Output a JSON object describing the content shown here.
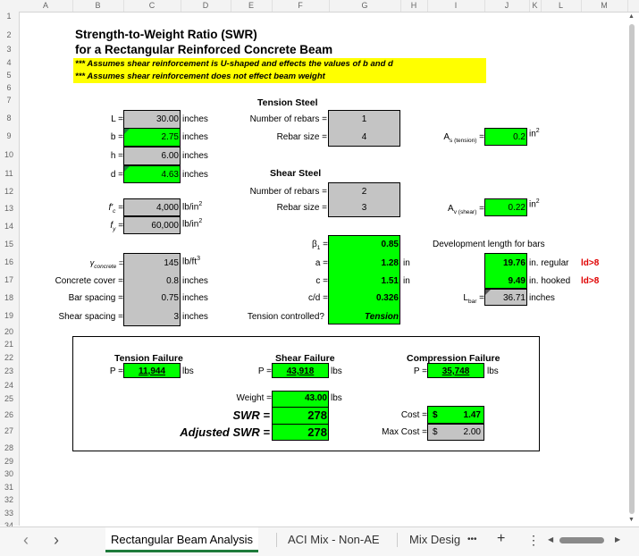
{
  "columns": [
    "A",
    "B",
    "C",
    "D",
    "E",
    "F",
    "G",
    "H",
    "I",
    "J",
    "K",
    "L",
    "M"
  ],
  "rows": [
    "1",
    "2",
    "3",
    "4",
    "5",
    "6",
    "7",
    "8",
    "9",
    "10",
    "11",
    "12",
    "13",
    "14",
    "15",
    "16",
    "17",
    "18",
    "19",
    "20",
    "21",
    "22",
    "23",
    "24",
    "25",
    "26",
    "27",
    "28",
    "29",
    "30",
    "31",
    "32",
    "33",
    "34"
  ],
  "title1": "Strength-to-Weight Ratio (SWR)",
  "title2": "for a Rectangular Reinforced Concrete Beam",
  "note1": "*** Assumes shear reinforcement is U-shaped and effects the values of b and d",
  "note2": "*** Assumes shear reinforcement does not effect beam weight",
  "dims": {
    "L_label": "L =",
    "L_val": "30.00",
    "L_unit": "inches",
    "b_label": "b =",
    "b_val": "2.75",
    "b_unit": "inches",
    "h_label": "h =",
    "h_val": "6.00",
    "h_unit": "inches",
    "d_label": "d =",
    "d_val": "4.63",
    "d_unit": "inches"
  },
  "materials": {
    "fc_label": "f'",
    "fc_sub": "c",
    "fc_eq": " =",
    "fc_val": "4,000",
    "fc_unit": "lb/in",
    "fc_sup": "2",
    "fy_label": "f",
    "fy_sub": "y",
    "fy_eq": " =",
    "fy_val": "60,000",
    "fy_unit": "lb/in",
    "fy_sup": "2"
  },
  "props": {
    "gamma_label": "γ",
    "gamma_sub": "concrete",
    "gamma_eq": " =",
    "gamma_val": "145",
    "gamma_unit": "lb/ft",
    "gamma_sup": "3",
    "cover_label": "Concrete cover =",
    "cover_val": "0.8",
    "cover_unit": "inches",
    "barsp_label": "Bar spacing =",
    "barsp_val": "0.75",
    "barsp_unit": "inches",
    "shearsp_label": "Shear spacing =",
    "shearsp_val": "3",
    "shearsp_unit": "inches"
  },
  "tension_steel": {
    "header": "Tension Steel",
    "num_label": "Number of rebars =",
    "num_val": "1",
    "size_label": "Rebar size =",
    "size_val": "4",
    "as_label": "A",
    "as_sub": "s (tension)",
    "as_eq": " =",
    "as_val": "0.2",
    "as_unit": "in",
    "as_sup": "2"
  },
  "shear_steel": {
    "header": "Shear Steel",
    "num_label": "Number of rebars =",
    "num_val": "2",
    "size_label": "Rebar size =",
    "size_val": "3",
    "av_label": "A",
    "av_sub": "v (shear)",
    "av_eq": " =",
    "av_val": "0.22",
    "av_unit": "in",
    "av_sup": "2"
  },
  "calc": {
    "beta_label": "β",
    "beta_sub": "1",
    "beta_eq": " =",
    "beta_val": "0.85",
    "a_label": "a =",
    "a_val": "1.28",
    "a_unit": "in",
    "c_label": "c =",
    "c_val": "1.51",
    "c_unit": "in",
    "cd_label": "c/d =",
    "cd_val": "0.326",
    "tc_label": "Tension controlled?",
    "tc_val": "Tension"
  },
  "development": {
    "header": "Development length for bars",
    "regular_val": "19.76",
    "regular_unit": "in. regular",
    "regular_flag": "ld>8",
    "hooked_val": "9.49",
    "hooked_unit": "in. hooked",
    "hooked_flag": "ld>8",
    "lbar_label": "L",
    "lbar_sub": "bar",
    "lbar_eq": " =",
    "lbar_val": "36.71",
    "lbar_unit": "inches"
  },
  "results": {
    "tension_header": "Tension Failure",
    "tension_p_label": "P =",
    "tension_p_val": "11,944",
    "tension_p_unit": "lbs",
    "shear_header": "Shear Failure",
    "shear_p_label": "P =",
    "shear_p_val": "43,918",
    "shear_p_unit": "lbs",
    "comp_header": "Compression Failure",
    "comp_p_label": "P =",
    "comp_p_val": "35,748",
    "comp_p_unit": "lbs",
    "weight_label": "Weight =",
    "weight_val": "43.00",
    "weight_unit": "lbs",
    "swr_label": "SWR =",
    "swr_val": "278",
    "adj_label": "Adjusted SWR =",
    "adj_val": "278",
    "cost_label": "Cost =",
    "cost_cur": "$",
    "cost_val": "1.47",
    "maxcost_label": "Max Cost =",
    "maxcost_cur": "$",
    "maxcost_val": "2.00"
  },
  "tabs": {
    "prev": "‹",
    "next": "›",
    "tab1": "Rectangular Beam Analysis",
    "tab2": "ACI Mix - Non-AE",
    "tab3": "Mix Desig",
    "more": "•••",
    "add": "+",
    "menu": "⋮"
  },
  "colors": {
    "green": "#00ff00",
    "grey": "#c4c4c4",
    "yellow": "#ffff00",
    "red": "#e00000",
    "tab_accent": "#1d7a3a"
  }
}
